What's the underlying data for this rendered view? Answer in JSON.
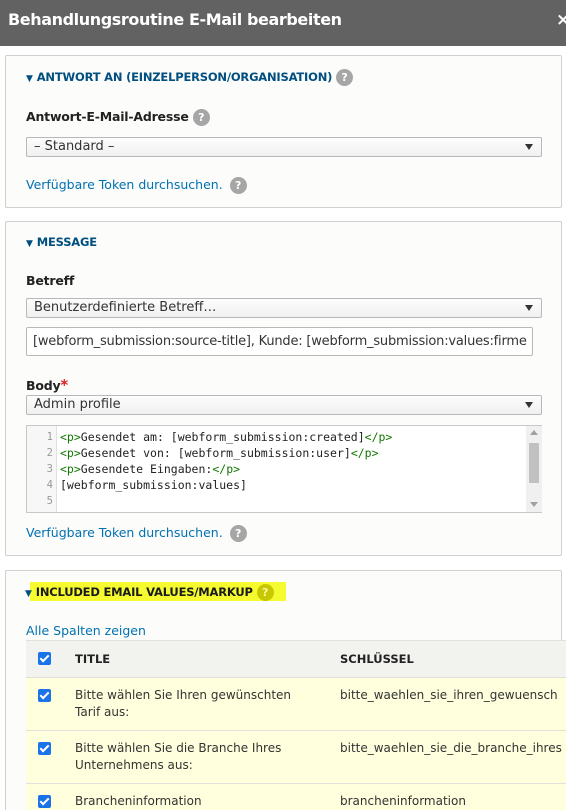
{
  "window": {
    "title": "Behandlungsroutine E-Mail bearbeiten",
    "close_label": "×"
  },
  "reply_section": {
    "heading": "ANTWORT AN (EINZELPERSON/ORGANISATION)",
    "field_label": "Antwort-E-Mail-Adresse",
    "select_value": "– Standard –",
    "token_link": "Verfügbare Token durchsuchen."
  },
  "message_section": {
    "heading": "MESSAGE",
    "subject_label": "Betreff",
    "subject_select": "Benutzerdefinierte Betreff…",
    "subject_value": "[webform_submission:source-title], Kunde: [webform_submission:values:firme",
    "body_label": "Body",
    "required_marker": "*",
    "body_select": "Admin profile",
    "code_lines": [
      {
        "num": "1",
        "open": "<p>",
        "text": "Gesendet am: [webform_submission:created]",
        "close": "</p>"
      },
      {
        "num": "2",
        "open": "<p>",
        "text": "Gesendet von: [webform_submission:user]",
        "close": "</p>"
      },
      {
        "num": "3",
        "open": "<p>",
        "text": "Gesendete Eingaben:",
        "close": "</p>"
      },
      {
        "num": "4",
        "open": "",
        "text": "[webform_submission:values]",
        "close": ""
      },
      {
        "num": "5",
        "open": "",
        "text": "",
        "close": ""
      }
    ],
    "token_link": "Verfügbare Token durchsuchen."
  },
  "values_section": {
    "heading": "INCLUDED EMAIL VALUES/MARKUP",
    "show_all_link": "Alle Spalten zeigen",
    "columns": [
      "TITLE",
      "SCHLÜSSEL"
    ],
    "rows": [
      {
        "title": "Bitte wählen Sie Ihren gewünschten Tarif aus:",
        "key": "bitte_waehlen_sie_ihren_gewuensch"
      },
      {
        "title": "Bitte wählen Sie die Branche Ihres Unternehmens aus:",
        "key": "bitte_waehlen_sie_die_branche_ihres"
      },
      {
        "title": "Brancheninformation",
        "key": "brancheninformation"
      }
    ]
  },
  "colors": {
    "titlebar": "#626262",
    "link": "#0071b3",
    "heading": "#004f80",
    "highlight": "#f6fb30",
    "selected_row": "#ffffdd",
    "checkbox": "#1a73e8"
  },
  "icons": {
    "help": "question-mark-circle",
    "collapse": "triangle-down",
    "checkbox": "checkmark"
  }
}
